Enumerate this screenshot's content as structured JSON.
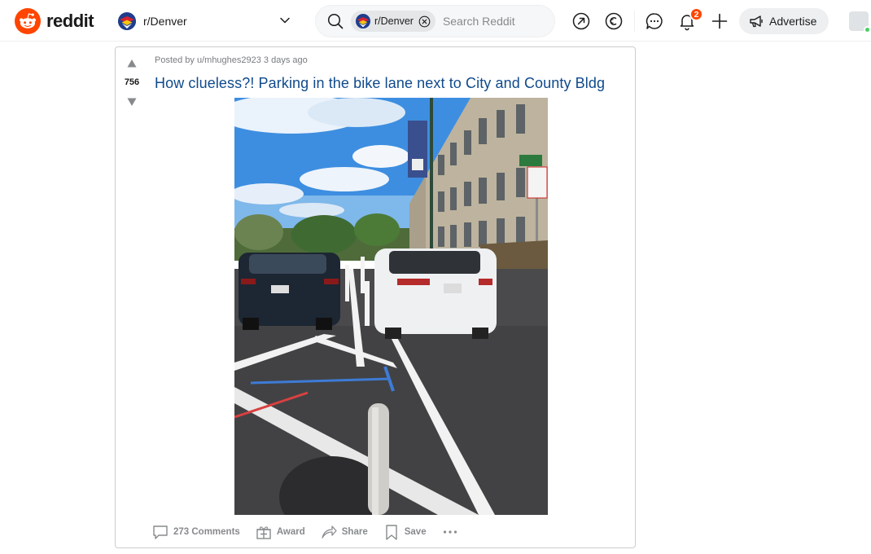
{
  "app": {
    "brand": "reddit",
    "brand_color": "#ff4500"
  },
  "header": {
    "community": "r/Denver",
    "search_chip": "r/Denver",
    "search_placeholder": "Search Reddit",
    "notification_count": "2",
    "advertise_label": "Advertise"
  },
  "post": {
    "meta": "Posted by u/mhughes2923 3 days ago",
    "score": "756",
    "title": "How clueless?! Parking in the bike lane next to City and County Bldg",
    "actions": {
      "comments": "273 Comments",
      "award": "Award",
      "share": "Share",
      "save": "Save"
    }
  },
  "icons": [
    "reddit-logo-icon",
    "denver-flag-icon",
    "chevron-down-icon",
    "search-icon",
    "clear-icon",
    "popular-icon",
    "coins-icon",
    "chat-icon",
    "bell-icon",
    "plus-icon",
    "megaphone-icon",
    "avatar",
    "upvote-icon",
    "downvote-icon",
    "comment-icon",
    "gift-icon",
    "share-icon",
    "bookmark-icon",
    "more-icon"
  ]
}
